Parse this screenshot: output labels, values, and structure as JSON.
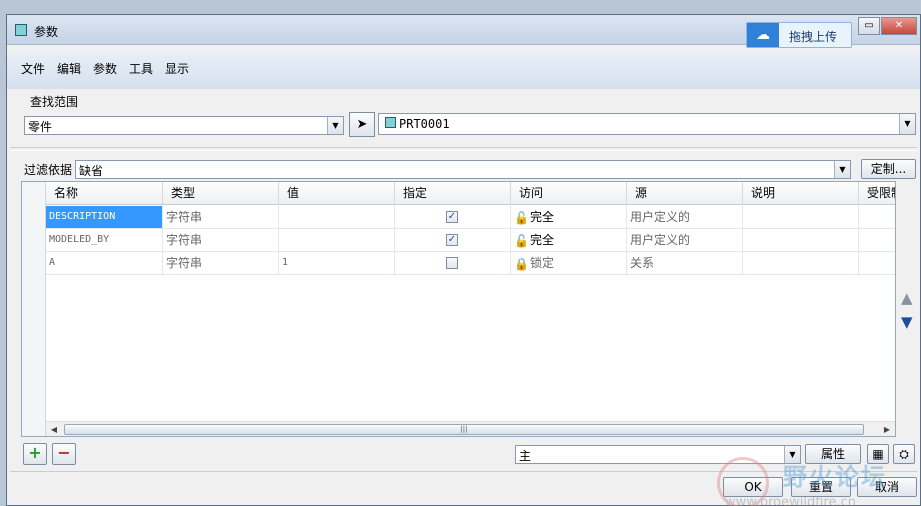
{
  "window": {
    "title": "参数"
  },
  "cloud_upload": {
    "label": "拖拽上传",
    "icon": "cloud-icon"
  },
  "window_controls": {
    "minimize": "▭",
    "close": "✕"
  },
  "menu": [
    "文件",
    "编辑",
    "参数",
    "工具",
    "显示"
  ],
  "search_scope": {
    "label": "查找范围",
    "type_value": "零件",
    "object_value": "PRT0001"
  },
  "filter": {
    "label": "过滤依据",
    "value": "缺省",
    "customize_label": "定制..."
  },
  "table": {
    "columns": [
      "名称",
      "类型",
      "值",
      "指定",
      "访问",
      "源",
      "说明",
      "受限制"
    ],
    "rows": [
      {
        "name": "DESCRIPTION",
        "type": "字符串",
        "value": "",
        "designated": true,
        "access": "完全",
        "access_icon": "unlock-icon",
        "source": "用户定义的",
        "description": "",
        "restricted": "",
        "selected": true
      },
      {
        "name": "MODELED_BY",
        "type": "字符串",
        "value": "",
        "designated": true,
        "access": "完全",
        "access_icon": "unlock-icon",
        "source": "用户定义的",
        "description": "",
        "restricted": "",
        "selected": false
      },
      {
        "name": "A",
        "type": "字符串",
        "value": "1",
        "designated": false,
        "access": "锁定",
        "access_icon": "lock-icon",
        "source": "关系",
        "description": "",
        "restricted": "",
        "selected": false
      }
    ]
  },
  "bottom": {
    "add_label": "+",
    "remove_label": "−",
    "property_select": "主",
    "property_button": "属性",
    "ok_label": "OK",
    "reset_label": "重置",
    "cancel_label": "取消"
  },
  "watermark": {
    "text": "野火论坛",
    "url": "www.proewildfire.cn"
  },
  "colors": {
    "selection": "#3399ff",
    "add": "#2e9b2e",
    "remove": "#c62828",
    "titlebar": "#c4d3e6"
  }
}
